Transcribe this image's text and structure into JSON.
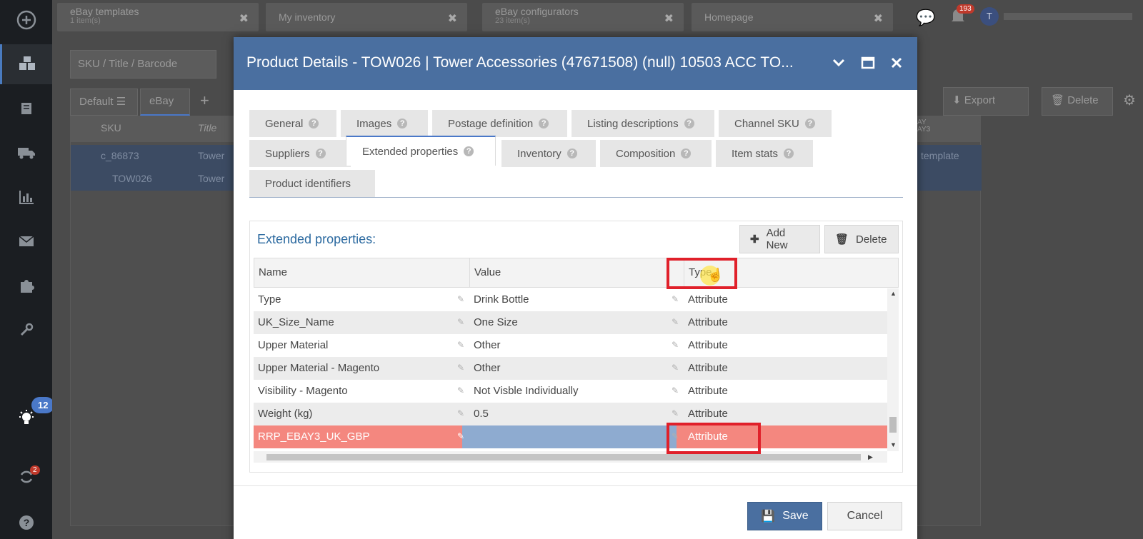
{
  "background": {
    "tabs": [
      {
        "title": "eBay templates",
        "sub": "1 item(s)"
      },
      {
        "title": "My inventory",
        "sub": ""
      },
      {
        "title": "eBay configurators",
        "sub": "23 item(s)"
      },
      {
        "title": "Homepage",
        "sub": ""
      }
    ],
    "notification_count": "193",
    "sync_count": "2",
    "idea_count": "12",
    "search_placeholder": "SKU / Title / Barcode",
    "view_default": "Default",
    "view_ebay": "eBay",
    "export_label": "Export",
    "delete_label": "Delete",
    "grid_col_sku": "SKU",
    "grid_col_title": "Title",
    "grid_row1_sku": "c_86873",
    "grid_row1_title": "Tower",
    "grid_row2_sku": "TOW026",
    "grid_row2_title": "Tower",
    "grid_right_text": "template",
    "grid_right_head": "AY\nAY3",
    "avatar_letter": "T"
  },
  "modal": {
    "title": "Product Details - TOW026 | Tower Accessories (47671508) (null) 10503 ACC TO...",
    "tabs_row1": [
      "General",
      "Images",
      "Postage definition",
      "Listing descriptions",
      "Channel SKU"
    ],
    "tabs_row2": [
      "Suppliers",
      "Extended properties",
      "Inventory",
      "Composition",
      "Item stats"
    ],
    "tabs_row3": [
      "Product identifiers"
    ],
    "active_tab": "Extended properties",
    "panel_title": "Extended properties:",
    "add_new_label": "Add New",
    "delete_label": "Delete",
    "columns": [
      "Name",
      "Value",
      "Type"
    ],
    "rows": [
      {
        "name": "Type",
        "value": "Drink Bottle",
        "type": "Attribute"
      },
      {
        "name": "UK_Size_Name",
        "value": "One Size",
        "type": "Attribute"
      },
      {
        "name": "Upper Material",
        "value": "Other",
        "type": "Attribute"
      },
      {
        "name": "Upper Material - Magento",
        "value": "Other",
        "type": "Attribute"
      },
      {
        "name": "Visibility - Magento",
        "value": "Not Visble Individually",
        "type": "Attribute"
      },
      {
        "name": "Weight (kg)",
        "value": "0.5",
        "type": "Attribute"
      },
      {
        "name": "RRP_EBAY3_UK_GBP",
        "value": "",
        "type": "Attribute"
      }
    ],
    "save_label": "Save",
    "cancel_label": "Cancel",
    "highlight_color": "#f4877f",
    "accent_color": "#4a6fa0"
  }
}
